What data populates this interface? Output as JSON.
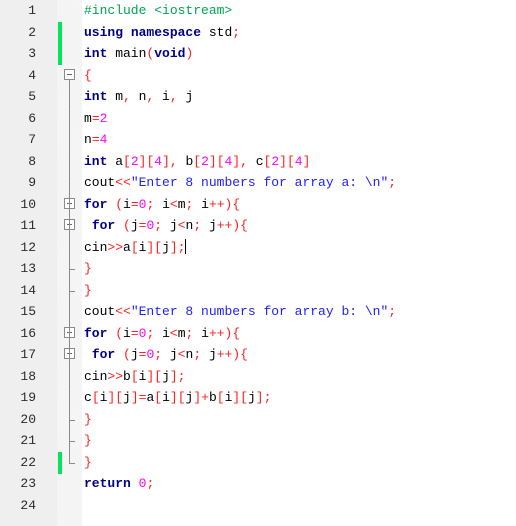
{
  "editor": {
    "language": "C++",
    "caret_line": 12,
    "changed_lines": [
      2,
      3,
      22
    ],
    "fold_markers": [
      4,
      10,
      11,
      16,
      17
    ],
    "lines": [
      {
        "n": "1",
        "tokens": [
          [
            "pp",
            "#include <iostream>"
          ]
        ]
      },
      {
        "n": "2",
        "tokens": [
          [
            "kw",
            "using"
          ],
          [
            "",
            " "
          ],
          [
            "kw",
            "namespace"
          ],
          [
            "",
            " std"
          ],
          [
            "op",
            ";"
          ]
        ]
      },
      {
        "n": "3",
        "tokens": [
          [
            "kw",
            "int"
          ],
          [
            "",
            " main"
          ],
          [
            "op",
            "("
          ],
          [
            "kw",
            "void"
          ],
          [
            "op",
            ")"
          ]
        ]
      },
      {
        "n": "4",
        "tokens": [
          [
            "op",
            "{"
          ]
        ]
      },
      {
        "n": "5",
        "tokens": [
          [
            "kw",
            "int"
          ],
          [
            "",
            " m"
          ],
          [
            "op",
            ","
          ],
          [
            "",
            " n"
          ],
          [
            "op",
            ","
          ],
          [
            "",
            " i"
          ],
          [
            "op",
            ","
          ],
          [
            "",
            " j"
          ]
        ]
      },
      {
        "n": "6",
        "tokens": [
          [
            "",
            "m"
          ],
          [
            "op",
            "="
          ],
          [
            "num",
            "2"
          ]
        ]
      },
      {
        "n": "7",
        "tokens": [
          [
            "",
            "n"
          ],
          [
            "op",
            "="
          ],
          [
            "num",
            "4"
          ]
        ]
      },
      {
        "n": "8",
        "tokens": [
          [
            "kw",
            "int"
          ],
          [
            "",
            " a"
          ],
          [
            "op",
            "["
          ],
          [
            "num",
            "2"
          ],
          [
            "op",
            "]["
          ],
          [
            "num",
            "4"
          ],
          [
            "op",
            "],"
          ],
          [
            "",
            " b"
          ],
          [
            "op",
            "["
          ],
          [
            "num",
            "2"
          ],
          [
            "op",
            "]["
          ],
          [
            "num",
            "4"
          ],
          [
            "op",
            "],"
          ],
          [
            "",
            " c"
          ],
          [
            "op",
            "["
          ],
          [
            "num",
            "2"
          ],
          [
            "op",
            "]["
          ],
          [
            "num",
            "4"
          ],
          [
            "op",
            "]"
          ]
        ]
      },
      {
        "n": "9",
        "tokens": [
          [
            "",
            "cout"
          ],
          [
            "op",
            "<<"
          ],
          [
            "str",
            "\"Enter 8 numbers for array a: \\n\""
          ],
          [
            "op",
            ";"
          ]
        ]
      },
      {
        "n": "10",
        "tokens": [
          [
            "kw",
            "for"
          ],
          [
            "",
            " "
          ],
          [
            "op",
            "("
          ],
          [
            "",
            "i"
          ],
          [
            "op",
            "="
          ],
          [
            "num",
            "0"
          ],
          [
            "op",
            ";"
          ],
          [
            "",
            " i"
          ],
          [
            "op",
            "<"
          ],
          [
            "",
            "m"
          ],
          [
            "op",
            ";"
          ],
          [
            "",
            " i"
          ],
          [
            "op",
            "++){"
          ]
        ]
      },
      {
        "n": "11",
        "tokens": [
          [
            "",
            " "
          ],
          [
            "kw",
            "for"
          ],
          [
            "",
            " "
          ],
          [
            "op",
            "("
          ],
          [
            "",
            "j"
          ],
          [
            "op",
            "="
          ],
          [
            "num",
            "0"
          ],
          [
            "op",
            ";"
          ],
          [
            "",
            " j"
          ],
          [
            "op",
            "<"
          ],
          [
            "",
            "n"
          ],
          [
            "op",
            ";"
          ],
          [
            "",
            " j"
          ],
          [
            "op",
            "++){"
          ]
        ]
      },
      {
        "n": "12",
        "tokens": [
          [
            "",
            "cin"
          ],
          [
            "op",
            ">>"
          ],
          [
            "",
            "a"
          ],
          [
            "op",
            "["
          ],
          [
            "",
            "i"
          ],
          [
            "op",
            "]["
          ],
          [
            "",
            "j"
          ],
          [
            "op",
            "];"
          ]
        ]
      },
      {
        "n": "13",
        "tokens": [
          [
            "op",
            "}"
          ]
        ]
      },
      {
        "n": "14",
        "tokens": [
          [
            "op",
            "}"
          ]
        ]
      },
      {
        "n": "15",
        "tokens": [
          [
            "",
            "cout"
          ],
          [
            "op",
            "<<"
          ],
          [
            "str",
            "\"Enter 8 numbers for array b: \\n\""
          ],
          [
            "op",
            ";"
          ]
        ]
      },
      {
        "n": "16",
        "tokens": [
          [
            "kw",
            "for"
          ],
          [
            "",
            " "
          ],
          [
            "op",
            "("
          ],
          [
            "",
            "i"
          ],
          [
            "op",
            "="
          ],
          [
            "num",
            "0"
          ],
          [
            "op",
            ";"
          ],
          [
            "",
            " i"
          ],
          [
            "op",
            "<"
          ],
          [
            "",
            "m"
          ],
          [
            "op",
            ";"
          ],
          [
            "",
            " i"
          ],
          [
            "op",
            "++){"
          ]
        ]
      },
      {
        "n": "17",
        "tokens": [
          [
            "",
            " "
          ],
          [
            "kw",
            "for"
          ],
          [
            "",
            " "
          ],
          [
            "op",
            "("
          ],
          [
            "",
            "j"
          ],
          [
            "op",
            "="
          ],
          [
            "num",
            "0"
          ],
          [
            "op",
            ";"
          ],
          [
            "",
            " j"
          ],
          [
            "op",
            "<"
          ],
          [
            "",
            "n"
          ],
          [
            "op",
            ";"
          ],
          [
            "",
            " j"
          ],
          [
            "op",
            "++){"
          ]
        ]
      },
      {
        "n": "18",
        "tokens": [
          [
            "",
            "cin"
          ],
          [
            "op",
            ">>"
          ],
          [
            "",
            "b"
          ],
          [
            "op",
            "["
          ],
          [
            "",
            "i"
          ],
          [
            "op",
            "]["
          ],
          [
            "",
            "j"
          ],
          [
            "op",
            "];"
          ]
        ]
      },
      {
        "n": "19",
        "tokens": [
          [
            "",
            "c"
          ],
          [
            "op",
            "["
          ],
          [
            "",
            "i"
          ],
          [
            "op",
            "]["
          ],
          [
            "",
            "j"
          ],
          [
            "op",
            "]="
          ],
          [
            "",
            "a"
          ],
          [
            "op",
            "["
          ],
          [
            "",
            "i"
          ],
          [
            "op",
            "]["
          ],
          [
            "",
            "j"
          ],
          [
            "op",
            "]+"
          ],
          [
            "",
            "b"
          ],
          [
            "op",
            "["
          ],
          [
            "",
            "i"
          ],
          [
            "op",
            "]["
          ],
          [
            "",
            "j"
          ],
          [
            "op",
            "];"
          ]
        ]
      },
      {
        "n": "20",
        "tokens": [
          [
            "op",
            "}"
          ]
        ]
      },
      {
        "n": "21",
        "tokens": [
          [
            "op",
            "}"
          ]
        ]
      },
      {
        "n": "22",
        "tokens": [
          [
            "op",
            "}"
          ]
        ]
      },
      {
        "n": "23",
        "tokens": [
          [
            "kw",
            "return"
          ],
          [
            "",
            " "
          ],
          [
            "num",
            "0"
          ],
          [
            "op",
            ";"
          ]
        ]
      },
      {
        "n": "24",
        "tokens": []
      }
    ]
  }
}
